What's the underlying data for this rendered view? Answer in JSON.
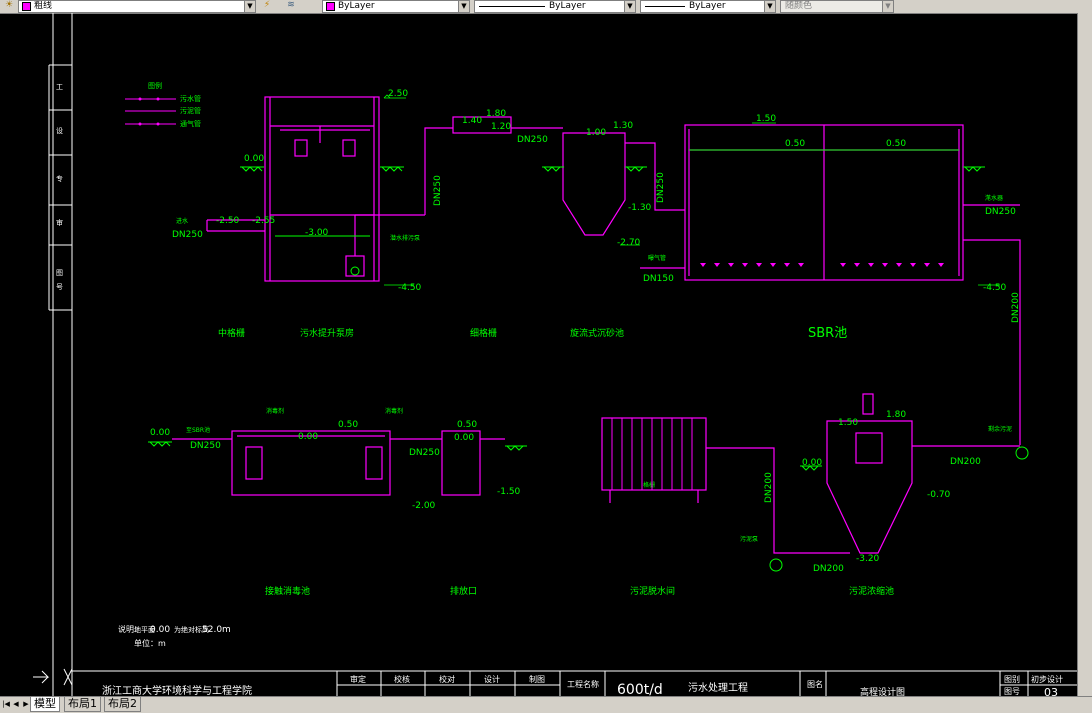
{
  "toolbar": {
    "linetype_value": "粗线",
    "color_value": "ByLayer",
    "linetype2_value": "ByLayer",
    "lineweight_value": "ByLayer",
    "plotstyle_value": "随颜色"
  },
  "colors": {
    "canvas": "#000000",
    "pipe": "#ff00ff",
    "label": "#00ff00",
    "frame": "#ffffff"
  },
  "legend": {
    "title": "图例",
    "items": [
      "污水管",
      "污泥管",
      "通气管"
    ]
  },
  "levels": {
    "l250a": "2.50",
    "l000a": "0.00",
    "l_250": "-2.50",
    "l_255": "-2.55",
    "l_300": "-3.00",
    "l_450a": "-4.50",
    "l140": "1.40",
    "l180a": "1.80",
    "l120": "1.20",
    "l100": "1.00",
    "l130": "1.30",
    "l_130": "-1.30",
    "l_270": "-2.70",
    "l150a": "1.50",
    "l050a": "0.50",
    "l050b": "0.50",
    "l_450b": "-4.50",
    "l000b": "0.00",
    "l000c": "0.00",
    "l050c": "0.50",
    "l_200": "-2.00",
    "l050d": "0.50",
    "l000d": "0.00",
    "l_150": "-1.50",
    "l000e": "0.00",
    "l150b": "1.50",
    "l180b": "1.80",
    "l_070": "-0.70",
    "l_320": "-3.20"
  },
  "pipes": {
    "inlet": "DN250",
    "p1": "DN250",
    "p2": "DN250",
    "p3": "DN250",
    "p4": "DN250",
    "p5": "DN150",
    "p6": "DN200",
    "p7": "DN250",
    "p8": "DN250",
    "p9": "DN200",
    "p10": "DN200",
    "p11": "DN200"
  },
  "notes": {
    "inlet": "进水",
    "pump_label": "潜水排污泵",
    "sludge_pipe": "排泥管",
    "aeration": "曝气管",
    "decanter": "滗水器",
    "sludge_pump": "污泥泵",
    "sludge_return": "剩余污泥",
    "grille_label": "格栅",
    "to_sbr": "至SBR池",
    "sludge_label": "污泥",
    "filtrate": "滤液",
    "disinfect1": "消毒剂",
    "disinfect2": "消毒剂"
  },
  "units": {
    "u1": "中格栅",
    "u2": "污水提升泵房",
    "u3": "细格栅",
    "u4": "旋流式沉砂池",
    "u5": "SBR池",
    "u6": "接触消毒池",
    "u7": "排放口",
    "u8": "污泥脱水间",
    "u9": "污泥浓缩池"
  },
  "note": {
    "line1_prefix": "说明：",
    "line1_a": "地平面",
    "line1_b": "0.00",
    "line1_c": "为绝对标高",
    "line1_d": "52.0m",
    "line2": "单位：m"
  },
  "title_block": {
    "org": "浙江工商大学环境科学与工程学院",
    "roles": [
      "审定",
      "校核",
      "校对",
      "设计",
      "制图"
    ],
    "project_label": "工程名称",
    "project_name_a": "600t/d",
    "project_name_b": "污水处理工程",
    "drawing_label": "图名",
    "drawing_name": "高程设计图",
    "type_label": "图别",
    "type_value": "初步设计",
    "no_label": "图号",
    "no_value": "03"
  },
  "layout_tabs": [
    "模型",
    "布局1",
    "布局2"
  ]
}
